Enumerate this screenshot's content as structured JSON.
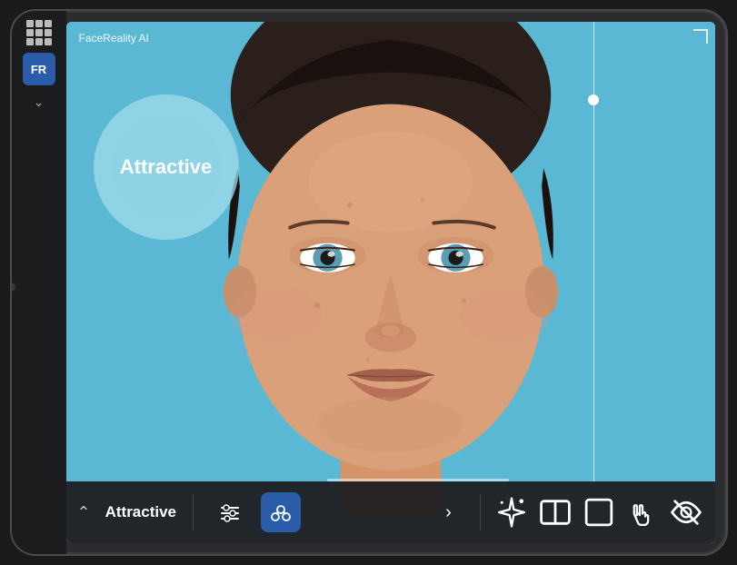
{
  "app": {
    "title": "FaceReality AI",
    "logo_text": "FR"
  },
  "bubble": {
    "label": "Attractive"
  },
  "toolbar": {
    "label": "Attractive",
    "icons": {
      "sliders": "sliders-icon",
      "circles": "circles-icon",
      "chevron_right": "chevron-right-icon",
      "sparkle": "sparkle-icon",
      "split": "split-icon",
      "square": "square-icon",
      "hand": "hand-icon",
      "eye": "eye-icon"
    }
  },
  "colors": {
    "background": "#5bb8d4",
    "sidebar": "#1c1c1e",
    "toolbar_bg": "#1e1e20",
    "badge_blue": "#2a5caa",
    "bubble": "rgba(160,220,235,0.75)"
  }
}
